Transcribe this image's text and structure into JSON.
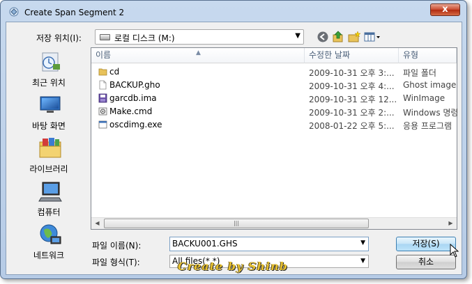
{
  "window": {
    "title": "Create Span Segment 2",
    "close_glyph": "x"
  },
  "save_in": {
    "label": "저장 위치(I):",
    "value": "로컬 디스크 (M:)"
  },
  "toolbar": {
    "back_icon": "back-arrow-icon",
    "up_icon": "up-folder-icon",
    "new_folder_icon": "new-folder-icon",
    "view_icon": "view-menu-icon"
  },
  "places": [
    {
      "label": "최근 위치",
      "icon": "recent-places-icon"
    },
    {
      "label": "바탕 화면",
      "icon": "desktop-icon"
    },
    {
      "label": "라이브러리",
      "icon": "libraries-icon"
    },
    {
      "label": "컴퓨터",
      "icon": "computer-icon"
    },
    {
      "label": "네트워크",
      "icon": "network-icon"
    }
  ],
  "columns": {
    "name": "이름",
    "date": "수정한 날짜",
    "type": "유형"
  },
  "files": [
    {
      "name": "cd",
      "date": "",
      "type": "파일 폴더",
      "icon": "folder"
    },
    {
      "name": "BACKUP.gho",
      "date": "2009-10-31 오후 4:...",
      "type": "Ghost image fi",
      "icon": "file"
    },
    {
      "name": "garcdb.ima",
      "date": "2009-10-31 오후 12...",
      "type": "WinImage",
      "icon": "image"
    },
    {
      "name": "Make.cmd",
      "date": "2009-10-31 오후 2:...",
      "type": "Windows 명령",
      "icon": "cmd"
    },
    {
      "name": "oscdimg.exe",
      "date": "2008-01-22 오후 5:...",
      "type": "응용 프로그램",
      "icon": "exe"
    }
  ],
  "cd_date": "2009-10-31 오후 3:...",
  "filename": {
    "label": "파일 이름(N):",
    "value": "BACKU001.GHS"
  },
  "filetype": {
    "label": "파일 형식(T):",
    "value": "All files(*.*)"
  },
  "buttons": {
    "save": "저장(S)",
    "cancel": "취소"
  },
  "watermark": "Create by Shinb"
}
